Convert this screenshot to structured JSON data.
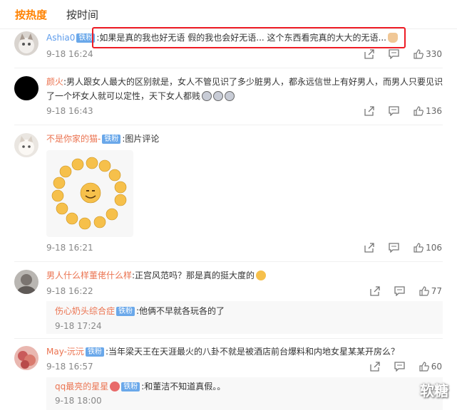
{
  "tabs": [
    {
      "label": "按热度"
    },
    {
      "label": "按时间"
    }
  ],
  "comments": [
    {
      "user": "Ashia0",
      "badge": "铁粉",
      "text": ":如果是真的我也好无语 假的我也会好无语... 这个东西看完真的大大的无语...",
      "time": "9-18 16:24",
      "likes": "330"
    },
    {
      "user": "颜火",
      "text_line1": ":男人跟女人最大的区别就是，女人不管见识了多少脏男人，都永远信世上有好男人，而男人只要见识",
      "text_line2": "了一个坏女人就可以定性，天下女人都贱",
      "time": "9-18 16:43",
      "likes": "136"
    },
    {
      "user": "不是你家的猫-",
      "badge": "铁粉",
      "text": ":图片评论",
      "time": "9-18 16:21",
      "likes": "106"
    },
    {
      "user": "男人什么样董佬什么样",
      "text": ":正宫风范吗？那是真的挺大度的",
      "time": "9-18 16:22",
      "likes": "77",
      "reply": {
        "user": "伤心奶头综合症",
        "badge": "铁粉",
        "text": ":他俩不早就各玩各的了",
        "time": "9-18 17:24"
      }
    },
    {
      "user": "May-沅沅",
      "badge": "铁粉",
      "text": ":当年梁天王在天涯最火的八卦不就是被酒店前台爆料和内地女星某某开房么？",
      "time": "9-18 16:57",
      "likes": "60",
      "reply": {
        "user": "qq最亮的星星",
        "badge": "铁粉",
        "text": ":和董洁不知道真假。。",
        "time": "9-18 18:00"
      }
    }
  ],
  "watermark": "软糖",
  "colors": {
    "accent": "#ff8200",
    "username": "#eb7350",
    "badge": "#6aa8ea",
    "highlight": "#ee1c25"
  }
}
